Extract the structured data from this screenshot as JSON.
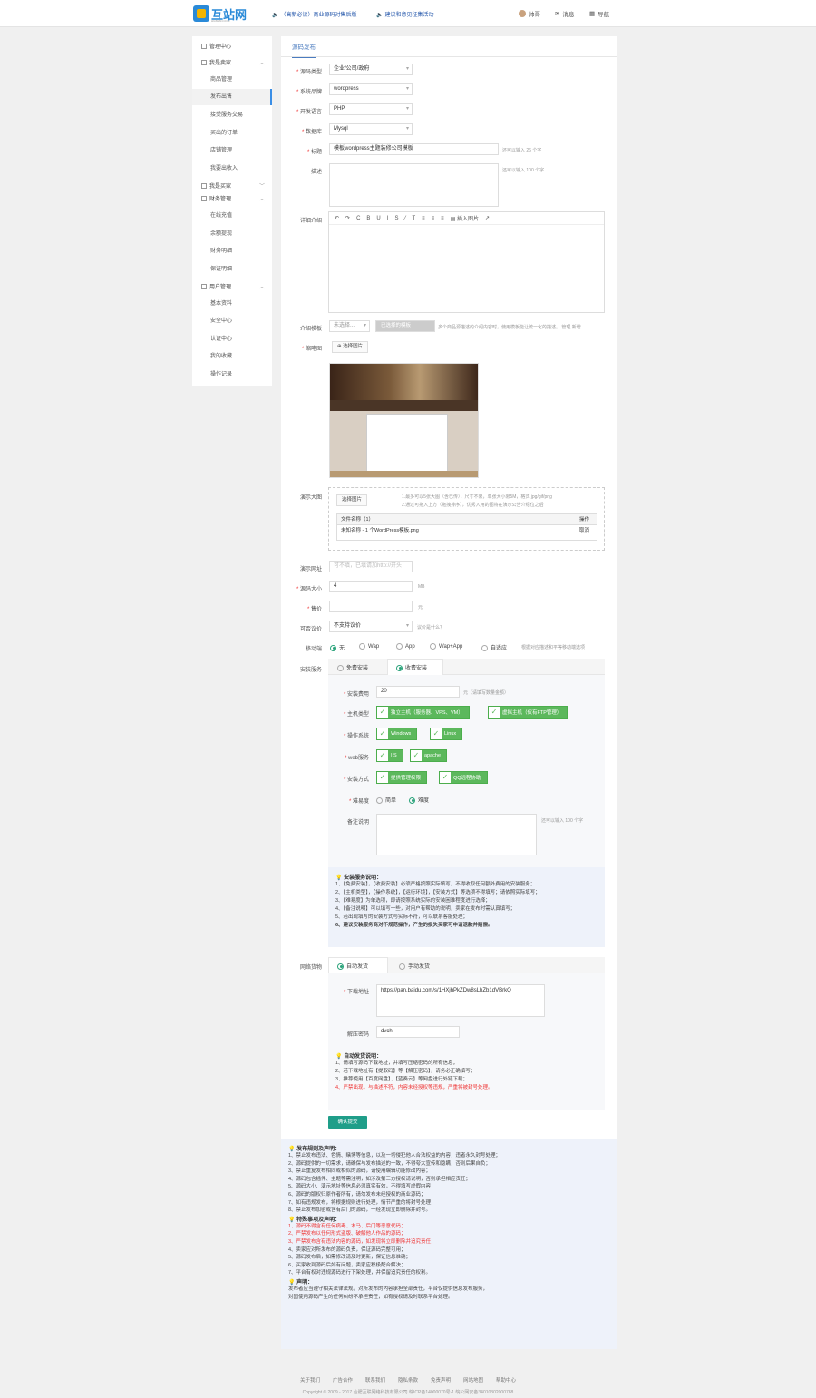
{
  "header": {
    "logo_text": "互站网",
    "logo_sub": "HUZHAN.COM",
    "notice1": "（高新必读）商业源码对售后版",
    "notice2": "建议和意见征集活动",
    "user": "帅哥",
    "messages": "消息",
    "nav": "导航"
  },
  "sidebar": {
    "home": "管理中心",
    "seller_group": "我是卖家",
    "items1": [
      "商品管理",
      "发布出售",
      "接受服务交易",
      "买出的订单",
      "店铺管理",
      "我要出收入"
    ],
    "buyer_group": "我是买家",
    "finance_group": "财务管理",
    "items2": [
      "在线充值",
      "余额提现",
      "财务明细",
      "保证明细"
    ],
    "user_group": "用户管理",
    "items3": [
      "基本资料",
      "安全中心",
      "认证中心",
      "我的收藏",
      "操作记录"
    ]
  },
  "form": {
    "tab": "源码发布",
    "type_label": "源码类型",
    "type_value": "企业/公司/政府",
    "system_label": "系统品牌",
    "system_value": "wordpress",
    "lang_label": "开发语言",
    "lang_value": "PHP",
    "db_label": "数据库",
    "db_value": "Mysql",
    "title_label": "标题",
    "title_value": "模板wordpress主题装修公司模板",
    "title_hint": "还可以输入 26 个字",
    "desc_label": "描述",
    "desc_hint": "还可以输入 100 个字",
    "detail_label": "详细介绍",
    "editor_tools": [
      "↶",
      "↷",
      "C",
      "B",
      "U",
      "I",
      "S",
      "⁄",
      "T",
      "≡",
      "≡",
      "≡",
      "▤ 插入图片",
      "↗"
    ],
    "tpl_label": "介绍模板",
    "tpl_value": "未选择...",
    "tpl_btn": "已选择的模板",
    "tpl_hint": "多个商品源描述的介绍内容时，使用模板能让统一化的描述。 管理 新增",
    "cover_label": "缩略图",
    "cover_btn": "选择图片",
    "demo_img_label": "演示大图",
    "demo_img_btn": "选择图片",
    "demo_img_hint1": "1.最多可以5张大图（含已传），尺寸不限，单张大小限5M，格式 jpg/gif/png",
    "demo_img_hint2": "2.通过可拖入上方（拖拽排序），优秀入用的图将在演示公告介绍位之后",
    "upload_head": "文件名称（1）",
    "upload_head_op": "操作",
    "upload_file": "未知名称 - 1 个WordPress模板.png",
    "upload_del": "取消",
    "demo_url_label": "演示网址",
    "demo_url_ph": "可不填，已填请加http://开头",
    "size_label": "源码大小",
    "size_value": "4",
    "size_unit": "MB",
    "price_label": "售价",
    "price_unit": "元",
    "bargain_label": "可否议价",
    "bargain_value": "不支持议价",
    "bargain_hint": "议价是什么？",
    "mobile_label": "移动端",
    "mobile_opts": [
      "无",
      "Wap",
      "App",
      "Wap+App",
      "自适应"
    ],
    "mobile_hint": "根据对应描述和平等移动端选项",
    "install_label": "安装服务",
    "install_opt1": "免费安装",
    "install_opt2": "收费安装",
    "fee_label": "安装费用",
    "fee_value": "20",
    "fee_hint": "元（请填写数量金额）",
    "host_label": "主机类型",
    "host_opts": [
      "独立主机（服务器、VPS、VM）",
      "虚拟主机（仅有FTP管理）"
    ],
    "os_label": "操作系统",
    "os_opts": [
      "Windows",
      "Linux"
    ],
    "web_label": "web服务",
    "web_opts": [
      "IIS",
      "apache"
    ],
    "mode_label": "安装方式",
    "mode_opts": [
      "提供管理权限",
      "QQ远程协助"
    ],
    "diff_label": "难易度",
    "diff_opts": [
      "简单",
      "难度"
    ],
    "remark_label": "备注说明",
    "remark_hint": "还可以输入 100 个字",
    "note_title": "安装服务说明：",
    "notes": [
      "1、【免费安装】，【收费安装】必须严格按照实际填写，不得收取任何额外费用的安装服务；",
      "2、【主机类型】，【操作系统】，【运行环境】，【安装方式】等选项不得填写；请依照实际填写；",
      "3、【难易度】为单选项，即请按照系统实际的安装困难程度进行选择；",
      "4、【备注说明】可以填写一些，对用户有帮助的说明，卖家在发布时需认真填写；",
      "5、若出现填写的安装方式与实际不符，可以联系客服处理；",
      "6、建议安装服务商对不规范操作，产生的损失买家可申请退款并赔偿。"
    ],
    "download_label": "网络货物",
    "dl_opt1": "自动发货",
    "dl_opt2": "手动发货",
    "dl_addr_label": "下载地址",
    "dl_addr_value": "https://pan.baidu.com/s/1HXjhPkZDw8sLhZb1dVBrkQ",
    "dl_pwd_label": "解压密码",
    "dl_pwd_value": "dvch",
    "dl_note_title": "自动发货说明：",
    "dl_notes": [
      "1、请填写源码下载地址，并填写压缩密码的所有信息；",
      "2、若下载地址有【提取码】等【解压密码】，请务必正确填写；",
      "3、推荐使用【百度网盘】、【蓝奏云】等网盘进行外链下载；",
      "4、严禁出现，与描述不符，内容未经授权等违规，严重将被封号处理。"
    ],
    "submit": "确认提交"
  },
  "rules": {
    "title1": "发布规则及声明：",
    "r1": [
      "1、禁止发布违法、色情、赌博等信息，以及一切侵犯他人合法权益的内容，违者永久封号处理；",
      "2、源码提供的一切需求，请确保与发布描述的一致，不得夸大宣传和隐瞒，否则后果自负；",
      "3、禁止重复发布相同或相似的源码，请使用编辑功能修改内容；",
      "4、源码包含插件、主题等需注明，如涉及第三方授权请说明，否则承担相应责任；",
      "5、源码大小、演示地址等信息必须真实有效，不得填写虚假内容；",
      "6、源码的版权归原作者所有，请勿发布未经授权的商业源码；",
      "7、如有违规发布，将根据规则进行处理，情节严重的将封号处理；",
      "8、禁止发布加密或含有后门的源码，一经发现立即删除并封号。"
    ],
    "title2": "特殊事项及声明：",
    "r2": [
      "1、源码不得含有任何病毒、木马、后门等恶意代码；",
      "2、严禁发布以任何形式盗版、破解他人作品的源码；",
      "3、严禁发布含有违法内容的源码，如发现将立即删除并追究责任；",
      "4、卖家应对所发布的源码负责，保证源码完整可用；",
      "5、源码发布后，如需修改请及时更新，保证信息准确；",
      "6、买家收到源码后如有问题，卖家应积极配合解决；",
      "7、平台有权对违规源码进行下架处理，并保留追究责任的权利。"
    ],
    "title3": "声明：",
    "r3": [
      "发布者应当遵守相关法律法规，对所发布的内容承担全部责任，平台仅提供信息发布服务，",
      "对因使用源码产生的任何纠纷不承担责任，如有侵权请及时联系平台处理。"
    ]
  },
  "footer": {
    "links": [
      "关于我们",
      "广告合作",
      "联系我们",
      "隐私条款",
      "免责声明",
      "网站地图",
      "帮助中心"
    ],
    "copy": "Copyright © 2009 - 2017 合肥互联网络科技有限公司 皖ICP备14000070号-1 皖公网安备34010302000788"
  }
}
